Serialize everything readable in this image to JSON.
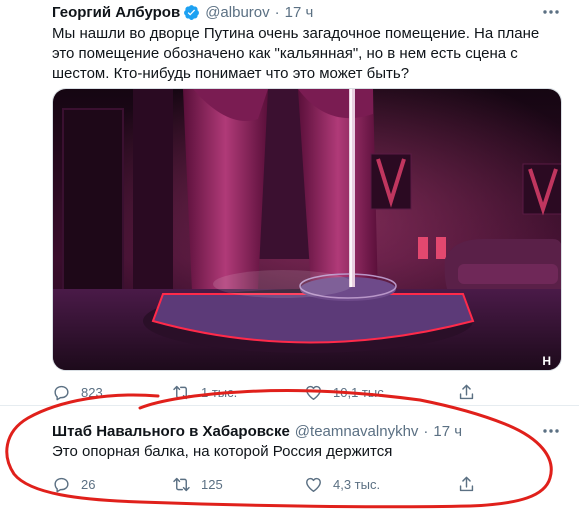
{
  "tweets": [
    {
      "author_name": "Георгий Албуров",
      "handle": "@alburov",
      "dot": "·",
      "time": "17 ч",
      "text": "Мы нашли во дворце Путина очень загадочное помещение. На плане это помещение обозначено как \"кальянная\", но в нем есть сцена с шестом. Кто-нибудь понимает что это может быть?",
      "replies": "823",
      "retweets": "1 тыс.",
      "likes": "10,1 тыс.",
      "media_watermark": "H"
    },
    {
      "author_name": "Штаб Навального в Хабаровске",
      "handle": "@teamnavalnykhv",
      "dot": "·",
      "time": "17 ч",
      "text": "Это опорная балка, на которой Россия держится",
      "replies": "26",
      "retweets": "125",
      "likes": "4,3 тыс."
    }
  ],
  "colors": {
    "accent": "#1da1f2",
    "secondary_text": "#5b7083",
    "annotation": "#e0201b"
  },
  "icons": [
    "verified-badge-icon",
    "more-icon",
    "reply-icon",
    "retweet-icon",
    "like-icon",
    "share-icon"
  ]
}
